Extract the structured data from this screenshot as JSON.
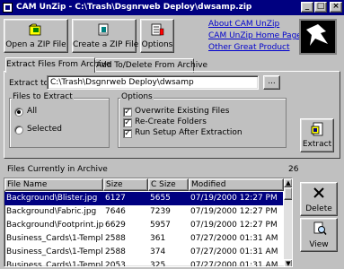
{
  "window": {
    "title": "CAM UnZip - C:\\Trash\\Dsgnrweb Deploy\\dwsamp.zip",
    "minimize": "_",
    "maximize": "□",
    "close": "×"
  },
  "toolbar": {
    "open_label": "Open a ZIP File",
    "create_label": "Create a ZIP File",
    "options_label": "Options"
  },
  "links": {
    "about": "About CAM UnZip",
    "home": "CAM UnZip Home Page",
    "other": "Other Great Product"
  },
  "tabs": [
    {
      "label": "Extract Files From Archive",
      "active": true
    },
    {
      "label": "Add To/Delete From Archive",
      "active": false
    }
  ],
  "extract": {
    "extract_to_label": "Extract to:",
    "extract_to_value": "C:\\Trash\\Dsgnrweb Deploy\\dwsamp",
    "browse_label": "...",
    "files_group_label": "Files to Extract",
    "radio_all": "All",
    "radio_selected": "Selected",
    "options_group_label": "Options",
    "opt_overwrite": "Overwrite Existing Files",
    "opt_recreate": "Re-Create Folders",
    "opt_run_setup": "Run Setup After Extraction",
    "extract_button": "Extract"
  },
  "archive": {
    "label": "Files Currently in Archive",
    "count": "26",
    "columns": [
      "File Name",
      "Size",
      "C Size",
      "Modified"
    ],
    "rows": [
      [
        "Background\\Blister.jpg",
        "6127",
        "5655",
        "07/19/2000 12:27 PM"
      ],
      [
        "Background\\Fabric.jpg",
        "7646",
        "7239",
        "07/19/2000 12:27 PM"
      ],
      [
        "Background\\Footprint.jpg",
        "6629",
        "5957",
        "07/19/2000 12:27 PM"
      ],
      [
        "Business_Cards\\1-Template",
        "2588",
        "361",
        "07/27/2000 01:31 AM"
      ],
      [
        "Business_Cards\\1-Template",
        "2588",
        "374",
        "07/27/2000 01:31 AM"
      ],
      [
        "Business_Cards\\1-Template",
        "2053",
        "325",
        "07/27/2000 01:31 AM"
      ]
    ],
    "selected_row": 0
  },
  "side": {
    "delete_label": "Delete",
    "view_label": "View"
  }
}
